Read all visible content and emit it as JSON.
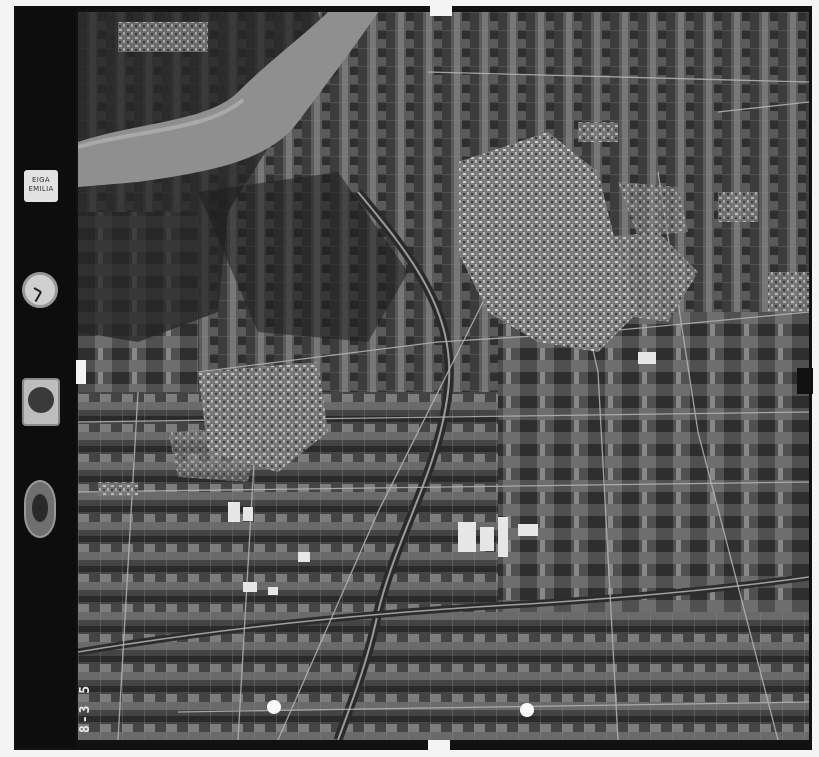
{
  "photo": {
    "label_card": {
      "line1": "EIGA",
      "line2": "EMILIA"
    },
    "frame_number": "8-3 5",
    "icons": [
      "clock-icon",
      "altimeter-icon",
      "level-bubble-icon"
    ]
  }
}
